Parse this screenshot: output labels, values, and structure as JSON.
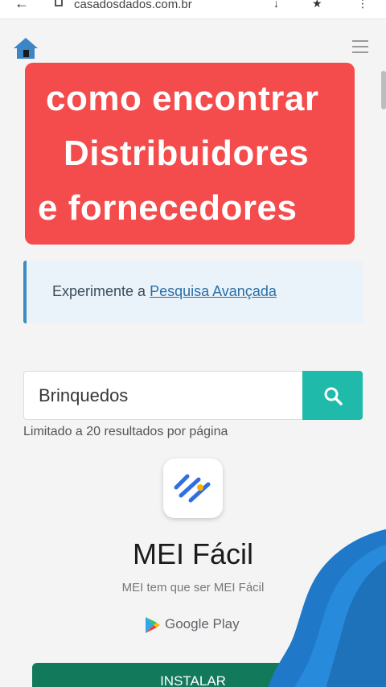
{
  "browser": {
    "url": "casadosdados.com.br"
  },
  "overlay": {
    "line1": "como encontrar",
    "line2": "Distribuidores",
    "line3": "e fornecedores"
  },
  "callout": {
    "prefix": "Experimente a ",
    "link": "Pesquisa Avançada"
  },
  "search": {
    "value": "Brinquedos",
    "limit_text": "Limitado a 20 resultados por página"
  },
  "ad": {
    "app_name": "MEI Fácil",
    "tagline": "MEI tem que ser MEI Fácil",
    "store": "Google Play",
    "install_label": "INSTALAR"
  },
  "colors": {
    "overlay_red": "#f44b4c",
    "search_teal": "#1fbaa9",
    "install_green": "#127a5b",
    "callout_blue": "#3a8cc1"
  }
}
